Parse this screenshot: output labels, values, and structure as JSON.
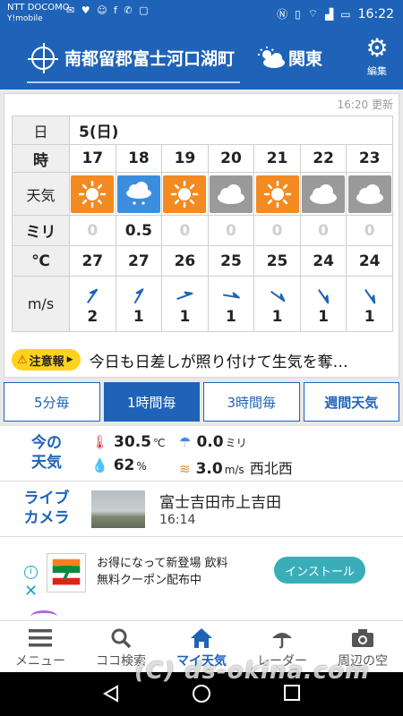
{
  "status_bar": {
    "carrier": "NTT DOCOMO",
    "carrier2": "Y!mobile",
    "time": "16:22",
    "icons": [
      "nfc-icon",
      "vibrate-icon",
      "wifi-icon",
      "signal-icon",
      "battery-icon"
    ]
  },
  "header": {
    "location": "南都留郡富士河口湖町",
    "region": "関東",
    "settings_label": "編集"
  },
  "forecast": {
    "updated": "16:20 更新",
    "row_labels": {
      "day": "日",
      "hour": "時",
      "weather": "天気",
      "rain": "ミリ",
      "temp": "℃",
      "wind": "m/s"
    },
    "day": "5(日)",
    "hours": [
      "17",
      "18",
      "19",
      "20",
      "21",
      "22",
      "23"
    ],
    "weather": [
      "sunny",
      "rain",
      "sunny",
      "cloudy",
      "sunny",
      "cloudy",
      "cloudy"
    ],
    "rain": [
      "0",
      "0.5",
      "0",
      "0",
      "0",
      "0",
      "0"
    ],
    "temps": [
      "27",
      "27",
      "26",
      "25",
      "25",
      "24",
      "24"
    ],
    "wind_speeds": [
      "2",
      "1",
      "1",
      "1",
      "1",
      "1",
      "1"
    ],
    "wind_arrow_angles": [
      -55,
      -60,
      -20,
      10,
      35,
      55,
      55
    ],
    "colors": {
      "sunny": "#f38a22",
      "rain": "#3d8ddf",
      "cloudy": "#9a9a9a"
    }
  },
  "warning": {
    "badge": "注意報",
    "text": "今日も日差しが照り付けて生気を奪…"
  },
  "tabs": [
    "5分毎",
    "1時間毎",
    "3時間毎",
    "週間天気"
  ],
  "current": {
    "label_line1": "今の",
    "label_line2": "天気",
    "temp": "30.5",
    "temp_unit": "℃",
    "rain": "0.0",
    "rain_unit": "ミリ",
    "humidity": "62",
    "humidity_unit": "%",
    "wind": "3.0",
    "wind_unit": "m/s",
    "wind_dir": "西北西"
  },
  "live_camera": {
    "label_line1": "ライブ",
    "label_line2": "カメラ",
    "place": "富士吉田市上吉田",
    "time": "16:14"
  },
  "ad": {
    "line1": "お得になって新登場 飲料",
    "line2": "無料クーポン配布中",
    "button": "インストール",
    "logo_text": "7 ELEVEN"
  },
  "bottom_nav": [
    "メニュー",
    "ココ検索",
    "マイ天気",
    "レーダー",
    "周辺の空"
  ],
  "watermark": "(C) ds-okina.com",
  "theme": {
    "primary": "#1e63b8",
    "warning": "#ffd21c",
    "accent": "#39aeb8"
  }
}
